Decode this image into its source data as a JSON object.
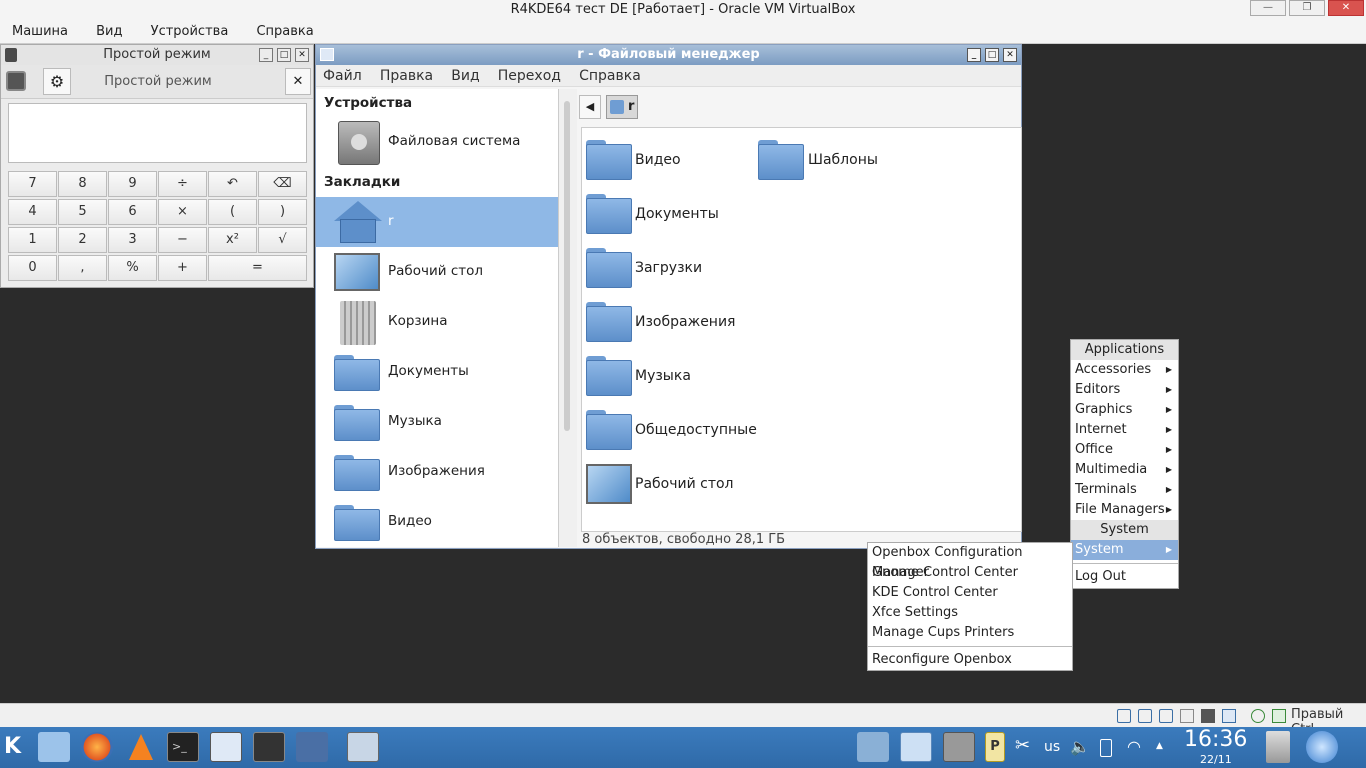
{
  "vbox": {
    "title": "R4KDE64 тест DE [Работает] - Oracle VM VirtualBox",
    "menu": [
      "Машина",
      "Вид",
      "Устройства",
      "Справка"
    ],
    "host_key": "Правый Ctrl"
  },
  "calculator": {
    "title": "Простой режим",
    "mode_label": "Простой режим",
    "display": "",
    "keys": [
      [
        "7",
        "8",
        "9",
        "÷",
        "↶",
        "⌫"
      ],
      [
        "4",
        "5",
        "6",
        "×",
        "(",
        ")"
      ],
      [
        "1",
        "2",
        "3",
        "−",
        "x²",
        "√"
      ],
      [
        "0",
        ",",
        "%",
        "+",
        "="
      ]
    ]
  },
  "filemanager": {
    "title": "r - Файловый менеджер",
    "menu": [
      "Файл",
      "Правка",
      "Вид",
      "Переход",
      "Справка"
    ],
    "sidebar": {
      "devices_header": "Устройства",
      "device": "Файловая система",
      "bookmarks_header": "Закладки",
      "bookmarks": [
        "r",
        "Рабочий стол",
        "Корзина",
        "Документы",
        "Музыка",
        "Изображения",
        "Видео"
      ]
    },
    "path": "r",
    "items_col1": [
      "Видео",
      "Документы",
      "Загрузки",
      "Изображения",
      "Музыка",
      "Общедоступные",
      "Рабочий стол"
    ],
    "items_col2": [
      "Шаблоны"
    ],
    "status": "8 объектов, свободно 28,1 ГБ"
  },
  "app_menu": {
    "header": "Applications",
    "items": [
      "Accessories",
      "Editors",
      "Graphics",
      "Internet",
      "Office",
      "Multimedia",
      "Terminals",
      "File Managers"
    ],
    "section2": "System",
    "selected": "System",
    "logout": "Log Out"
  },
  "system_submenu": {
    "items": [
      "Openbox Configuration Manager",
      "Gnome Control Center",
      "KDE Control Center",
      "Xfce Settings",
      "Manage Cups Printers"
    ],
    "last": "Reconfigure Openbox"
  },
  "taskbar": {
    "keyboard_layout": "us",
    "time": "16:36",
    "date": "22/11"
  }
}
